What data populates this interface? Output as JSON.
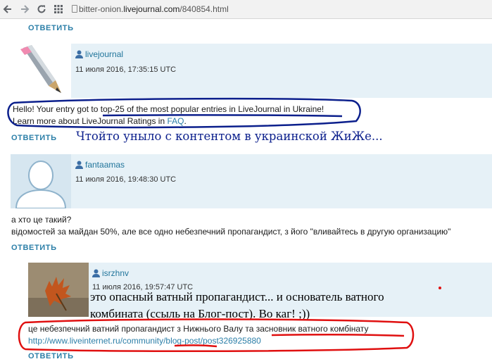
{
  "browser": {
    "url_host": "bitter-onion.",
    "url_domain": "livejournal.com",
    "url_path": "/840854.html"
  },
  "reply_label": "ОТВЕТИТЬ",
  "comments": [
    {
      "username": "livejournal",
      "date": "11 июля 2016, 17:35:15 UTC",
      "line1": "Hello! Your entry got to top-25 of the most popular entries in LiveJournal in Ukraine!",
      "line2_prefix": "Learn more about LiveJournal Ratings in ",
      "line2_link": "FAQ",
      "line2_suffix": "."
    },
    {
      "username": "fantaamas",
      "date": "11 июля 2016, 19:48:30 UTC",
      "line1": "а хто це такий?",
      "line2": "відомостей за майдан 50%, але все одно небезпечний пропагандист, з його \"вливайтесь в другую организацию\""
    },
    {
      "username": "isrzhnv",
      "date": "11 июля 2016, 19:57:47 UTC",
      "line1": "це небезпечний ватний пропагандист з Нижнього Валу та засновник ватного комбінату",
      "link": "http://www.liveinternet.ru/community/blog-post/post326925880"
    }
  ],
  "annotations": {
    "note1": "Чтойто уныло с контентом в украинской ЖиЖе...",
    "note2": "это опасный ватный пропагандист... и основатель ватного комбината (ссыль на Блог-пост). Во каг! ;))",
    "accent_blue": "#0b1f8c",
    "accent_red": "#e01010"
  }
}
